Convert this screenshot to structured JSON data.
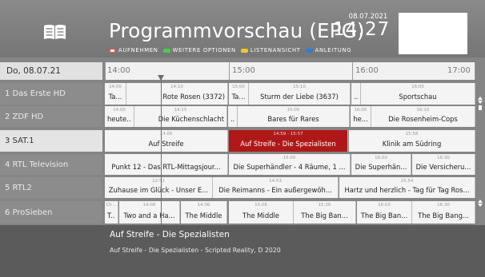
{
  "header": {
    "title": "Programmvorschau (EPG)",
    "date": "08.07.2021",
    "time": "14:27",
    "legend": [
      {
        "label": "Aufnehmen",
        "color": "#e8524b"
      },
      {
        "label": "Weitere Optionen",
        "color": "#3fd14a"
      },
      {
        "label": "Listenansicht",
        "color": "#f3c61c"
      },
      {
        "label": "Anleitung",
        "color": "#2a7fd8"
      }
    ]
  },
  "timeline": {
    "date_label": "Do, 08.07.21",
    "ticks": [
      "14:00",
      "15:00",
      "16:00",
      "17:00"
    ]
  },
  "channels": [
    "1 Das Erste HD",
    "2 ZDF HD",
    "3 SAT.1",
    "4 RTL Television",
    "5 RTL2",
    "6 ProSieben"
  ],
  "programs": [
    [
      {
        "time": "14:00",
        "name": "Ta..."
      },
      {
        "time": "14:10",
        "name": "Rote Rosen (3372)"
      },
      {
        "time": "15:00",
        "name": "Ta..."
      },
      {
        "time": "15:10",
        "name": "Sturm der Liebe (3637)"
      },
      {
        "time": "",
        "name": "..."
      },
      {
        "time": "16:05",
        "name": "Sportschau"
      }
    ],
    [
      {
        "time": "14:00",
        "name": "heute..."
      },
      {
        "time": "14:15",
        "name": "Die Küchenschlacht"
      },
      {
        "time": "",
        "name": "..."
      },
      {
        "time": "15:05",
        "name": "Bares für Rares"
      },
      {
        "time": "16:00",
        "name": "he..."
      },
      {
        "time": "16:10",
        "name": "Die Rosenheim-Cops"
      }
    ],
    [
      {
        "time": "14:00",
        "name": "Auf Streife"
      },
      {
        "time": "14:59 - 15:57",
        "name": "Auf Streife - Die Spezialisten"
      },
      {
        "time": "15:58",
        "name": "Klinik am Südring"
      }
    ],
    [
      {
        "time": "",
        "name": "Punkt 12 - Das RTL-Mittagsjour..."
      },
      {
        "time": "15:00",
        "name": "Die Superhändler - 4 Räume, 1 ..."
      },
      {
        "time": "16:00",
        "name": "Die Superhän..."
      },
      {
        "time": "16:30",
        "name": "Die Versicheru..."
      }
    ],
    [
      {
        "time": "12:52",
        "name": "Zuhause im Glück - Unser E..."
      },
      {
        "time": "14:53",
        "name": "Die Reimanns - Ein außergewöh..."
      },
      {
        "time": "15:54",
        "name": "Hartz und herzlich - Tag für Tag Ros..."
      }
    ],
    [
      {
        "time": "13:...",
        "name": "T..."
      },
      {
        "time": "14:08",
        "name": "Two and a Ha..."
      },
      {
        "time": "14:36",
        "name": "The Middle"
      },
      {
        "time": "15:06",
        "name": "The Middle"
      },
      {
        "time": "15:36",
        "name": "The Big Ban..."
      },
      {
        "time": "16:03",
        "name": "The Big Ban..."
      },
      {
        "time": "16:30",
        "name": "The Big Bang..."
      }
    ]
  ],
  "selected": {
    "title": "Auf Streife - Die Spezialisten",
    "details": "Auf Streife - Die Spezialisten - Scripted Reality, D 2020"
  }
}
